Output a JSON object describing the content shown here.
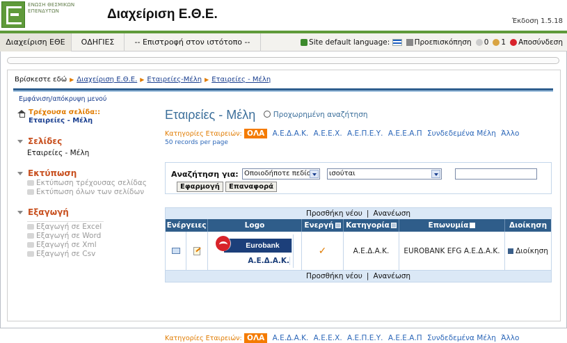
{
  "header": {
    "logo_text": "ΕΝΩΣΗ ΘΕΣΜΙΚΩΝ ΕΠΕΝΔΥΤΩΝ",
    "title": "Διαχείριση Ε.Θ.Ε.",
    "version": "Έκδοση 1.5.18"
  },
  "navbar": {
    "items": [
      "Διαχείριση ΕΘΕ",
      "ΟΔΗΓΙΕΣ",
      "-- Επιστροφή στον ιστότοπο --"
    ],
    "site_language_label": "Site default language:",
    "preview": "Προεπισκόπηση",
    "count_a": "0",
    "count_b": "1",
    "logout": "Αποσύνδεση"
  },
  "breadcrumb": {
    "prefix": "Βρίσκεστε εδώ",
    "items": [
      "Διαχείριση Ε.Θ.Ε.",
      "Εταιρείες-Μέλη",
      "Εταιρείες - Μέλη"
    ]
  },
  "sidebar": {
    "toggle": "Εμφάνιση/απόκρυψη μενού",
    "current_label": "Τρέχουσα σελίδα::",
    "current_value": "Εταιρείες - Μέλη",
    "pages_title": "Σελίδες",
    "pages_item": "Εταιρείες - Μέλη",
    "print_title": "Εκτύπωση",
    "print_items": [
      "Εκτύπωση τρέχουσας σελίδας",
      "Εκτύπωση όλων των σελίδων"
    ],
    "export_title": "Εξαγωγή",
    "export_items": [
      "Εξαγωγή σε Excel",
      "Εξαγωγή σε Word",
      "Εξαγωγή σε Xml",
      "Εξαγωγή σε Csv"
    ]
  },
  "content": {
    "title": "Εταιρείες - Μέλη",
    "advanced_search": "Προχωρημένη αναζήτηση",
    "categories_label": "Κατηγορίες Εταιρειών:",
    "categories": [
      "ΟΛΑ",
      "Α.Ε.Δ.Α.Κ.",
      "Α.Ε.Ε.Χ.",
      "Α.Ε.Π.Ε.Υ.",
      "Α.Ε.Ε.Α.Π",
      "Συνδεδεμένα Μέλη",
      "Άλλο"
    ],
    "records_per_page": "50 records per page",
    "bottom_categories": [
      "ΟΛΑ",
      "Α.Ε.Δ.Α.Κ.",
      "Α.Ε.Ε.Χ.",
      "Α.Ε.Π.Ε.Υ.",
      "Α.Ε.Ε.Α.Π",
      "Συνδεδεμένα Μέλη",
      "Άλλο"
    ]
  },
  "search": {
    "label": "Αναζήτηση για:",
    "field_value": "Οποιοδήποτε πεδίο",
    "operator_value": "ισούται",
    "query_value": "",
    "apply": "Εφαρμογή",
    "reset": "Επαναφορά"
  },
  "grid": {
    "add_new": "Προσθήκη νέου",
    "refresh": "Ανανέωση",
    "headers": [
      "Ενέργειες",
      "Logo",
      "Ενεργή",
      "Κατηγορία",
      "Επωνυμία",
      "Διοίκηση"
    ],
    "rows": [
      {
        "logo_name": "Eurobank",
        "logo_category": "Α.Ε.Δ.Α.Κ.",
        "active": "✓",
        "category": "Α.Ε.Δ.Α.Κ.",
        "name": "EUROBANK EFG Α.Ε.Δ.Α.Κ.",
        "admin": "Διοίκηση"
      }
    ]
  },
  "colors": {
    "brand_green": "#5f9a3a",
    "accent_orange": "#f47b00",
    "header_blue": "#2f5d8a",
    "link_blue": "#2b66b8"
  }
}
